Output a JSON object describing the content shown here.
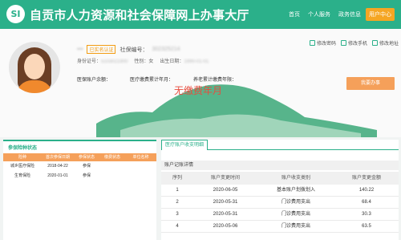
{
  "header": {
    "logo_text": "SI",
    "title": "自贡市人力资源和社会保障网上办事大厅",
    "nav": [
      "首页",
      "个人服务",
      "政务信息",
      "用户中心"
    ]
  },
  "profile": {
    "name": "▪▪▪",
    "verify_badge": "已实名认证",
    "si_number_label": "社保编号：",
    "si_number_value": "302325214",
    "id_label": "身份证号：",
    "id_value": "5103021900",
    "gender_label": "性别：",
    "gender_value": "女",
    "birth_label": "出生日期：",
    "birth_value": "1990-01-01",
    "links": [
      "修改密码",
      "修改手机",
      "修改地址"
    ],
    "stats": [
      "医保账户余额：",
      "医疗缴费累计年月：",
      "养老累计缴费年限："
    ],
    "no_payment": "无缴费年月",
    "handle_button": "我要办事"
  },
  "left_panel": {
    "title": "参保险种状态",
    "columns": [
      "险种",
      "首次参保日期",
      "参保状态",
      "缴费状态",
      "单位名称"
    ],
    "rows": [
      [
        "城乡医疗保险",
        "2018-04-22",
        "参保",
        "",
        ""
      ],
      [
        "生育保险",
        "2020-01-01",
        "参保",
        "",
        ""
      ]
    ]
  },
  "right_panel": {
    "tab": "医疗账户收支明细",
    "subtitle": "账户记账详情",
    "columns": [
      "序列",
      "账户变更时间",
      "账户收支类别",
      "账户变更金额"
    ],
    "rows": [
      [
        "1",
        "2020-06-05",
        "基本账户划拨划入",
        "140.22"
      ],
      [
        "2",
        "2020-05-31",
        "门诊费用支出",
        "68.4"
      ],
      [
        "3",
        "2020-05-31",
        "门诊费用支出",
        "30.3"
      ],
      [
        "4",
        "2020-05-06",
        "门诊费用支出",
        "63.5"
      ]
    ]
  },
  "colors": {
    "primary": "#2bb08a",
    "accent": "#f5a05a",
    "alert": "#e84c3d"
  }
}
